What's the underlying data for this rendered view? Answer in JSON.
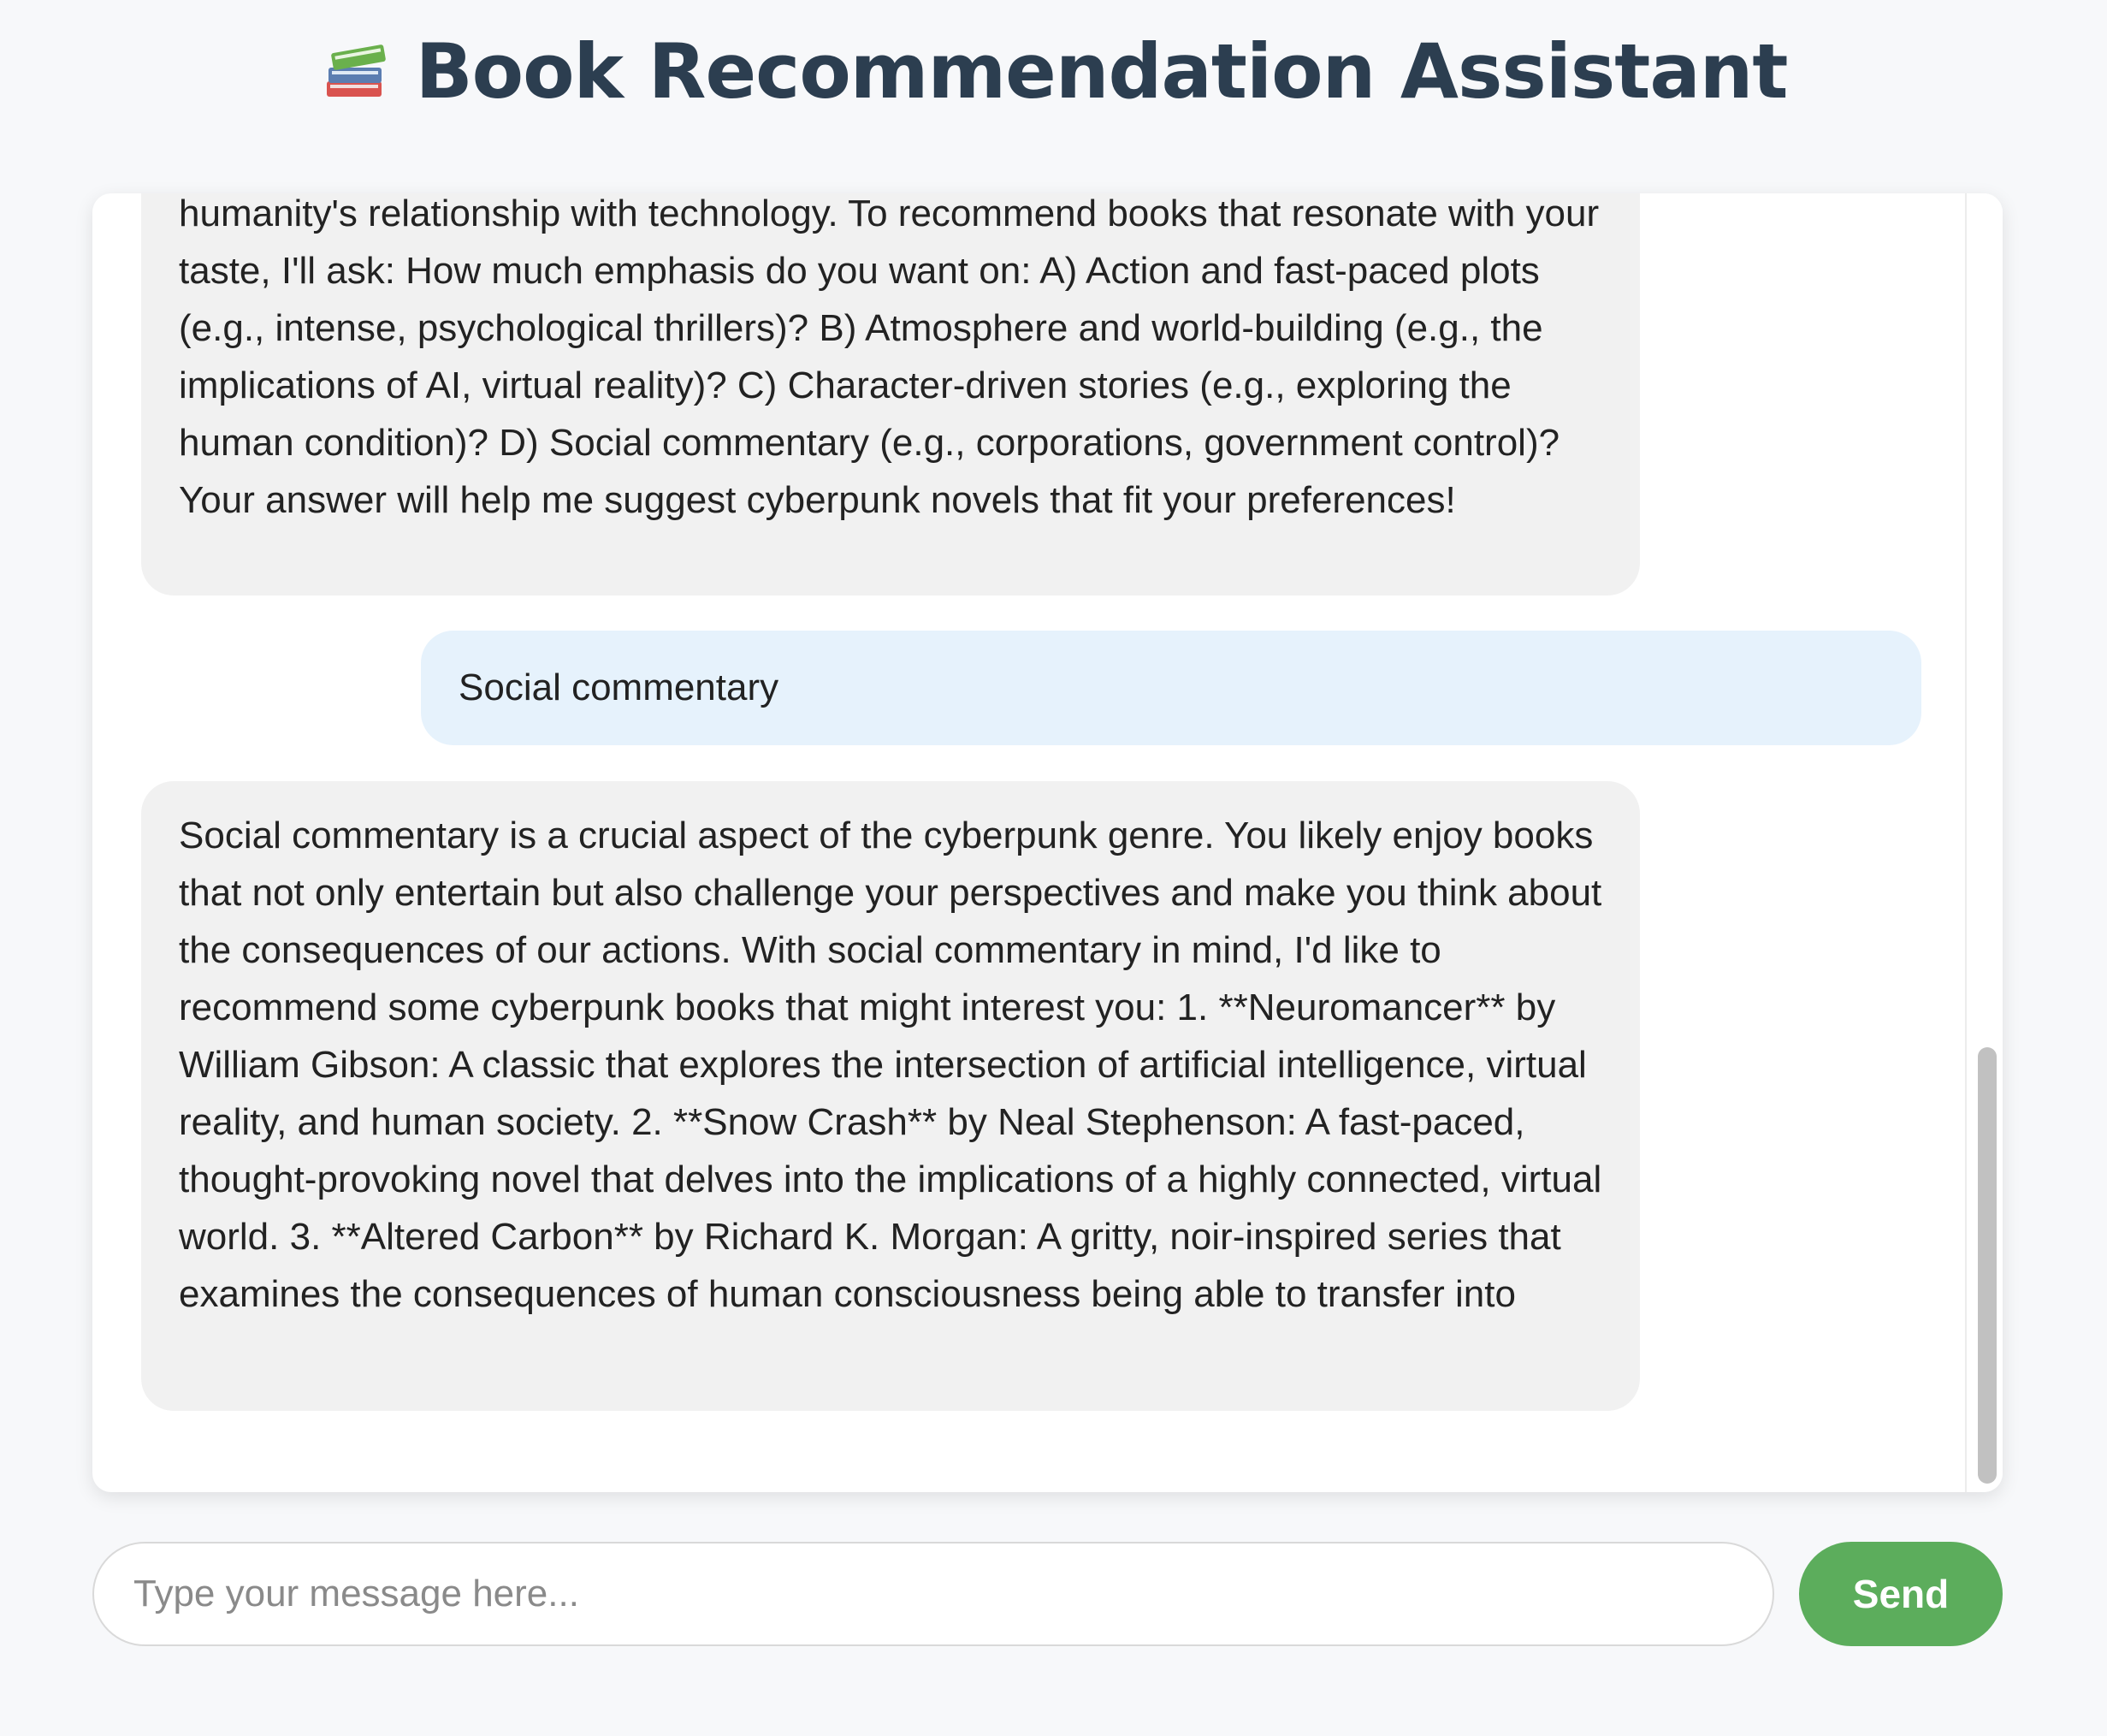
{
  "header": {
    "title": "Book Recommendation Assistant",
    "icon": "books-icon"
  },
  "chat": {
    "messages": [
      {
        "role": "assistant",
        "text": "humanity's relationship with technology. To recommend books that resonate with your taste, I'll ask: How much emphasis do you want on: A) Action and fast-paced plots (e.g., intense, psychological thrillers)? B) Atmosphere and world-building (e.g., the implications of AI, virtual reality)? C) Character-driven stories (e.g., exploring the human condition)? D) Social commentary (e.g., corporations, government control)? Your answer will help me suggest cyberpunk novels that fit your preferences!"
      },
      {
        "role": "user",
        "text": "Social commentary"
      },
      {
        "role": "assistant",
        "text": "Social commentary is a crucial aspect of the cyberpunk genre. You likely enjoy books that not only entertain but also challenge your perspectives and make you think about the consequences of our actions. With social commentary in mind, I'd like to recommend some cyberpunk books that might interest you: 1. **Neuromancer** by William Gibson: A classic that explores the intersection of artificial intelligence, virtual reality, and human society. 2. **Snow Crash** by Neal Stephenson: A fast-paced, thought-provoking novel that delves into the implications of a highly connected, virtual world. 3. **Altered Carbon** by Richard K. Morgan: A gritty, noir-inspired series that examines the consequences of human consciousness being able to transfer into"
      }
    ]
  },
  "composer": {
    "placeholder": "Type your message here...",
    "value": "",
    "send_label": "Send"
  },
  "colors": {
    "title": "#2c3e50",
    "bot_bubble": "#f1f1f1",
    "user_bubble": "#e6f2fc",
    "send_button": "#5cad5c",
    "page_background": "#f7f8fa"
  }
}
